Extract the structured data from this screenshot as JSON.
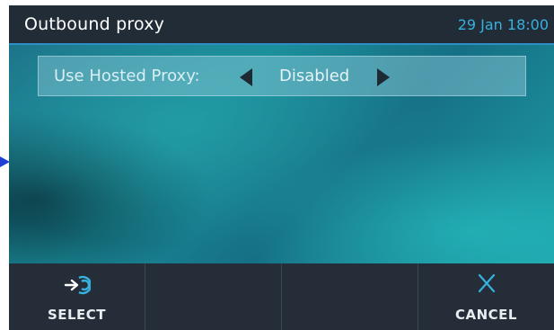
{
  "header": {
    "title": "Outbound proxy",
    "datetime": "29 Jan 18:00"
  },
  "setting": {
    "label": "Use Hosted Proxy:",
    "value": "Disabled"
  },
  "softkeys": [
    {
      "label": "SELECT",
      "icon": "select-arrow-icon"
    },
    {
      "label": "",
      "icon": ""
    },
    {
      "label": "",
      "icon": ""
    },
    {
      "label": "CANCEL",
      "icon": "close-icon"
    }
  ],
  "colors": {
    "accent": "#36b1e0",
    "header_bg": "#222c36",
    "softkey_bg": "#252e38"
  }
}
